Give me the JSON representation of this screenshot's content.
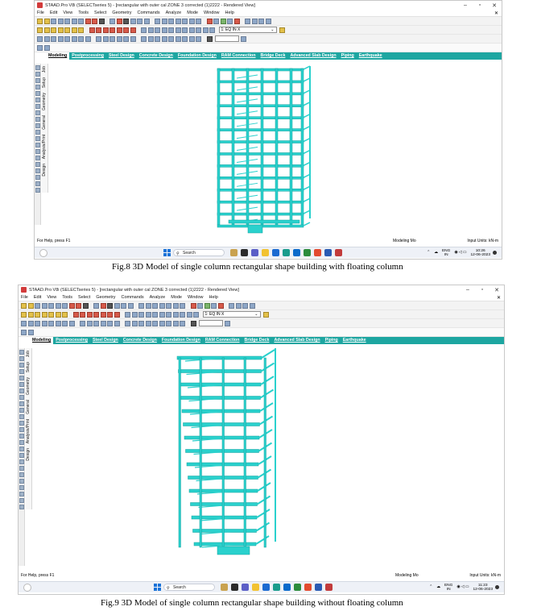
{
  "colors": {
    "accent_tab_bar": "#1da6a1",
    "structure": "#2ad1cd",
    "structure_edge": "#13a19e"
  },
  "screens": [
    {
      "window_title": "STAAD.Pro V8i (SELECTseries 5) - [rectangular with outer cal ZONE 3 corrected (1)2222 - Rendered View]",
      "menu": [
        "File",
        "Edit",
        "View",
        "Tools",
        "Select",
        "Geometry",
        "Commands",
        "Analyze",
        "Mode",
        "Window",
        "Help"
      ],
      "load_case": "1: EQ IN X",
      "tabs": [
        "Modeling",
        "Postprocessing",
        "Steel Design",
        "Concrete Design",
        "Foundation Design",
        "RAM Connection",
        "Bridge Deck",
        "Advanced Slab Design",
        "Piping",
        "Earthquake"
      ],
      "active_tab": "Modeling",
      "side_tabs": [
        "Setup",
        "Geometry",
        "General",
        "Analysis/Print",
        "Design"
      ],
      "side_tab_top": "Job",
      "status_help": "For Help, press F1",
      "status_mode": "Modeling Mo",
      "status_units": "Input Units:  kN-m",
      "search_placeholder": "Search",
      "lang": "ENG",
      "lang_region": "IN",
      "time": "10:26",
      "date": "12-06-2023",
      "caption": "Fig.8 3D Model of single column rectangular shape building with floating column"
    },
    {
      "window_title": "STAAD.Pro V8i (SELECTseries 5) - [rectangular with outer cal ZONE 3 corrected (1)2222 - Rendered View]",
      "menu": [
        "File",
        "Edit",
        "View",
        "Tools",
        "Select",
        "Geometry",
        "Commands",
        "Analyze",
        "Mode",
        "Window",
        "Help"
      ],
      "load_case": "1: EQ IN X",
      "tabs": [
        "Modeling",
        "Postprocessing",
        "Steel Design",
        "Concrete Design",
        "Foundation Design",
        "RAM Connection",
        "Bridge Deck",
        "Advanced Slab Design",
        "Piping",
        "Earthquake"
      ],
      "active_tab": "Modeling",
      "side_tabs": [
        "Setup",
        "Geometry",
        "General",
        "Analysis/Print",
        "Design"
      ],
      "side_tab_top": "Job",
      "status_help": "For Help, press F1",
      "status_mode": "Modeling Mo",
      "status_units": "Input Units:  kN-m",
      "search_placeholder": "Search",
      "lang": "ENG",
      "lang_region": "IN",
      "time": "11:23",
      "date": "12-06-2023",
      "caption": "Fig.9 3D Model of single column rectangular shape building without floating column"
    }
  ]
}
